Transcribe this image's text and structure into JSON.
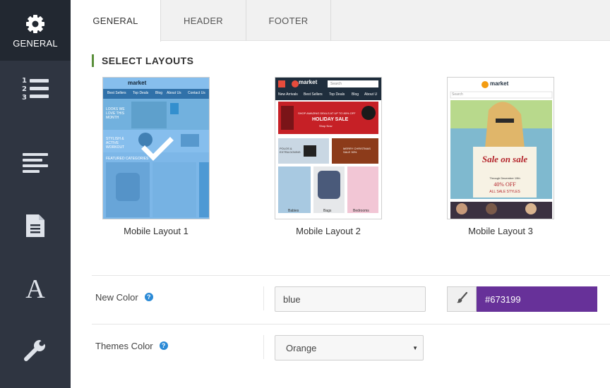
{
  "sidebar": {
    "items": [
      {
        "label": "GENERAL",
        "icon": "gear-icon",
        "active": true
      },
      {
        "label": "",
        "icon": "numbered-list-icon"
      },
      {
        "label": "",
        "icon": "align-left-icon"
      },
      {
        "label": "",
        "icon": "document-icon"
      },
      {
        "label": "",
        "icon": "font-icon"
      },
      {
        "label": "",
        "icon": "wrench-icon"
      }
    ]
  },
  "tabs": [
    {
      "label": "GENERAL",
      "active": true
    },
    {
      "label": "HEADER"
    },
    {
      "label": "FOOTER"
    }
  ],
  "section": {
    "title": "SELECT LAYOUTS"
  },
  "layouts": [
    {
      "label": "Mobile Layout 1",
      "selected": true,
      "thumb": {
        "brand": "market",
        "nav": [
          "Best Sellers",
          "Top Deals",
          "Blog",
          "About Us",
          "Contact Us"
        ],
        "banner_text": "LOOKS WE LOVE THIS MONTH",
        "promo_text": "STYLISH & ACTIVE WORKOUT",
        "section_text": "FEATURED CATEGORIES"
      }
    },
    {
      "label": "Mobile Layout 2",
      "thumb": {
        "brand": "market",
        "search_placeholder": "Search",
        "nav": [
          "New Arrivals",
          "Best Sellers",
          "Top Deals",
          "Blog",
          "About U"
        ],
        "banner_small": "SHOP AMAZING DEALS AT UP TO 80% OFF",
        "banner_big": "HOLIDAY SALE",
        "banner_link": "Shop Now",
        "promo_left": "POLOS & EXTRA DOWNS",
        "promo_right": "MERRY CHRISTMAS SALE 30%",
        "categories": [
          "Babies",
          "Bags",
          "Bedrooms"
        ]
      }
    },
    {
      "label": "Mobile Layout 3",
      "thumb": {
        "brand": "market",
        "search_placeholder": "Search",
        "sale_title": "Sale on sale",
        "sale_sub": "Through December 19th",
        "sale_pct": "40% OFF",
        "sale_note": "ALL SALE STYLES"
      }
    }
  ],
  "form": {
    "new_color": {
      "label": "New Color",
      "help": "?",
      "value": "blue",
      "hex": "#673199"
    },
    "themes_color": {
      "label": "Themes Color",
      "help": "?",
      "value": "Orange"
    }
  },
  "colors": {
    "sidebar": "#2f3541",
    "sidebar_active": "#222831",
    "accent": "#5a8f3a",
    "picker": "#673199",
    "help": "#2b8ad6"
  }
}
